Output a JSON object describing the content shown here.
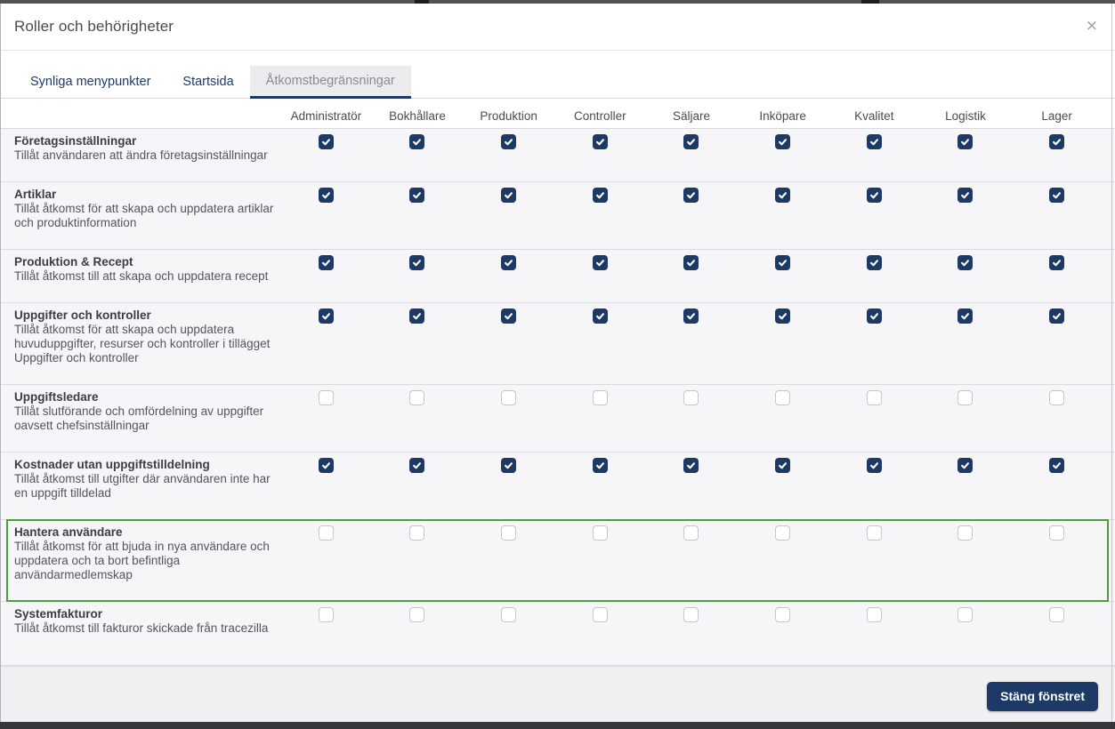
{
  "modal": {
    "title": "Roller och behörigheter",
    "close_icon": "×"
  },
  "tabs": [
    {
      "label": "Synliga menypunkter",
      "active": false
    },
    {
      "label": "Startsida",
      "active": false
    },
    {
      "label": "Åtkomstbegränsningar",
      "active": true
    }
  ],
  "table": {
    "columns": [
      "Administratör",
      "Bokhållare",
      "Produktion",
      "Controller",
      "Säljare",
      "Inköpare",
      "Kvalitet",
      "Logistik",
      "Lager"
    ],
    "rows": [
      {
        "title": "Företagsinställningar",
        "description": "Tillåt användaren att ändra företagsinställningar",
        "checked": true,
        "highlighted": false
      },
      {
        "title": "Artiklar",
        "description": "Tillåt åtkomst för att skapa och uppdatera artiklar och produktinformation",
        "checked": true,
        "highlighted": false
      },
      {
        "title": "Produktion & Recept",
        "description": "Tillåt åtkomst till att skapa och uppdatera recept",
        "checked": true,
        "highlighted": false
      },
      {
        "title": "Uppgifter och kontroller",
        "description": "Tillåt åtkomst för att skapa och uppdatera huvuduppgifter, resurser och kontroller i tillägget Uppgifter och kontroller",
        "checked": true,
        "highlighted": false
      },
      {
        "title": "Uppgiftsledare",
        "description": "Tillåt slutförande och omfördelning av uppgifter oavsett chefsinställningar",
        "checked": false,
        "highlighted": false
      },
      {
        "title": "Kostnader utan uppgiftstilldelning",
        "description": "Tillåt åtkomst till utgifter där användaren inte har en uppgift tilldelad",
        "checked": true,
        "highlighted": false
      },
      {
        "title": "Hantera användare",
        "description": "Tillåt åtkomst för att bjuda in nya användare och uppdatera och ta bort befintliga användarmedlemskap",
        "checked": false,
        "highlighted": true
      },
      {
        "title": "Systemfakturor",
        "description": "Tillåt åtkomst till fakturor skickade från tracezilla",
        "checked": false,
        "highlighted": false
      }
    ]
  },
  "footer": {
    "close_button_label": "Stäng fönstret"
  },
  "colors": {
    "accent_navy": "#1d3a66",
    "highlight_green": "#4f9d3f",
    "row_background": "#f6f6f8",
    "footer_background": "#f0f0f2"
  }
}
